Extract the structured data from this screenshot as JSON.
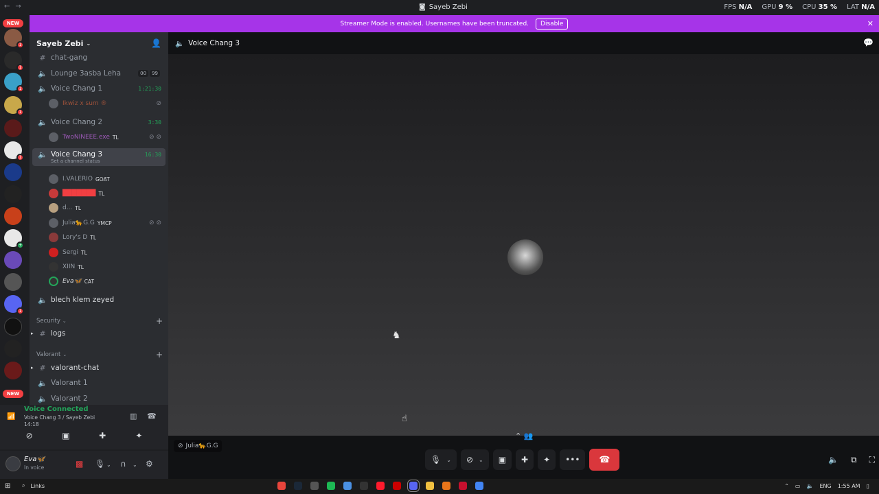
{
  "window": {
    "title": "Sayeb Zebi",
    "stats": [
      {
        "label": "FPS",
        "value": "N/A"
      },
      {
        "label": "GPU",
        "value": "9 %"
      },
      {
        "label": "CPU",
        "value": "35 %"
      },
      {
        "label": "LAT",
        "value": "N/A"
      }
    ]
  },
  "banner": {
    "text": "Streamer Mode is enabled. Usernames have been truncated.",
    "button": "Disable"
  },
  "server_list": {
    "new_badge_top": "NEW",
    "new_badge_bottom": "NEW"
  },
  "guild": {
    "name": "Sayeb Zebi"
  },
  "channels": {
    "chat_gang": "chat-gang",
    "lounge": {
      "name": "Lounge 3asba Leha",
      "count_a": "00",
      "count_b": "99"
    },
    "vc1": {
      "name": "Voice Chang 1",
      "timer": "1:21:30",
      "user": "Ikwiz x sum ®"
    },
    "vc2": {
      "name": "Voice Chang 2",
      "timer": "3:30",
      "user": "TwoNINEEE.exe",
      "user_tag": "TL"
    },
    "vc3": {
      "name": "Voice Chang 3",
      "timer": "16:30",
      "status": "Set a channel status",
      "users": [
        {
          "name": "I.VALERIO",
          "tag": "GOAT",
          "color": "#949ba4"
        },
        {
          "name": "███████",
          "tag": "TL",
          "color": "#f23f42"
        },
        {
          "name": "d...",
          "tag": "TL",
          "color": "#949ba4"
        },
        {
          "name": "Julia🐆G.G",
          "tag": "YMCP",
          "color": "#949ba4"
        },
        {
          "name": "Lory's D",
          "tag": "TL",
          "color": "#949ba4"
        },
        {
          "name": "Sergi",
          "tag": "TL",
          "color": "#949ba4"
        },
        {
          "name": "XIIN",
          "tag": "TL",
          "color": "#949ba4"
        },
        {
          "name": "Eva🦋",
          "tag": "CAT",
          "color": "#dbdee1"
        }
      ]
    },
    "blech": "blech klem zeyed",
    "security_category": "Security",
    "logs": "logs",
    "valorant_category": "Valorant",
    "valorant_chat": "valorant-chat",
    "valorant1": "Valorant 1",
    "valorant2": "Valorant 2"
  },
  "voice_panel": {
    "title": "Voice Connected",
    "sub": "Voice Chang 3 / Sayeb Zebi",
    "time": "14:18"
  },
  "user_panel": {
    "name": "Eva🦋",
    "status": "In voice"
  },
  "main": {
    "channel": "Voice Chang 3",
    "tile_label": "Julia🐆G.G"
  },
  "taskbar": {
    "search": "Links",
    "lang": "ENG",
    "clock": "1:55 AM"
  },
  "colors": {
    "banner": "#a634e8",
    "connected": "#23a55a",
    "hangup": "#da373c"
  }
}
